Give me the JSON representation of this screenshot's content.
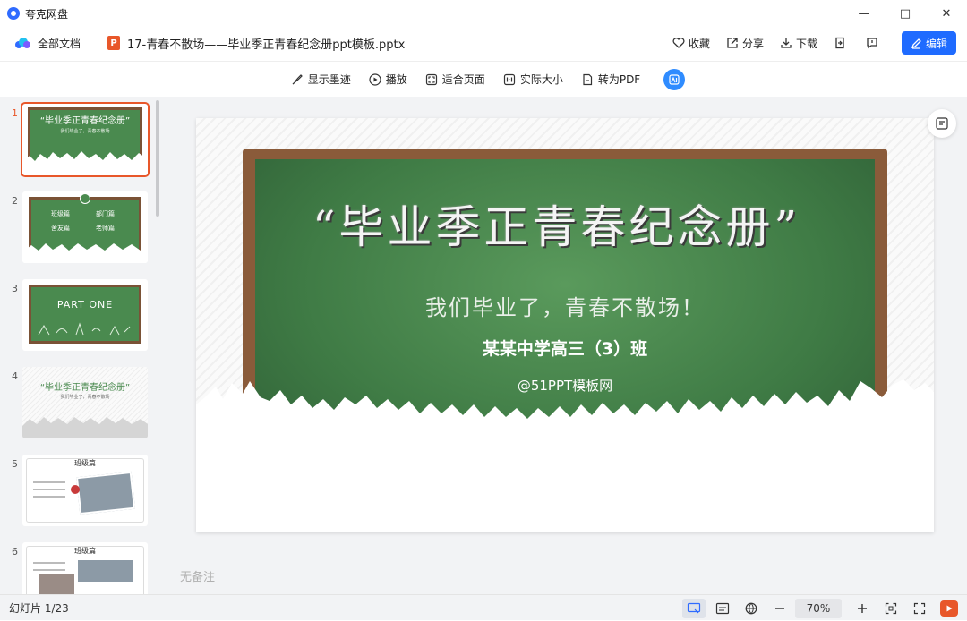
{
  "window": {
    "app_title": "夸克网盘"
  },
  "header": {
    "all_docs": "全部文档",
    "file_badge": "P",
    "file_name": "17-青春不散场——毕业季正青春纪念册ppt模板.pptx",
    "actions": {
      "favorite": "收藏",
      "share": "分享",
      "download": "下载",
      "edit": "编辑"
    }
  },
  "toolbar": {
    "show_ink": "显示墨迹",
    "play": "播放",
    "fit_page": "适合页面",
    "actual_size": "实际大小",
    "to_pdf": "转为PDF"
  },
  "sidebar": {
    "thumbnails": [
      {
        "num": "1",
        "title": "“毕业季正青春纪念册”",
        "sub": "我们毕业了，青春不散场"
      },
      {
        "num": "2",
        "items": [
          "班级篇",
          "部门篇",
          "舍友篇",
          "老师篇"
        ]
      },
      {
        "num": "3",
        "title": "PART ONE"
      },
      {
        "num": "4",
        "title": "“毕业季正青春纪念册”",
        "sub": "我们毕业了，青春不散场"
      },
      {
        "num": "5",
        "title": "班级篇"
      },
      {
        "num": "6",
        "title": "班级篇"
      }
    ]
  },
  "slide": {
    "title": "“毕业季正青春纪念册”",
    "subtitle": "我们毕业了，青春不散场！",
    "class_name": "某某中学高三（3）班",
    "brand": "@51PPT模板网"
  },
  "notes_placeholder": "无备注",
  "status": {
    "slide_count": "幻灯片 1/23",
    "zoom": "70%"
  }
}
